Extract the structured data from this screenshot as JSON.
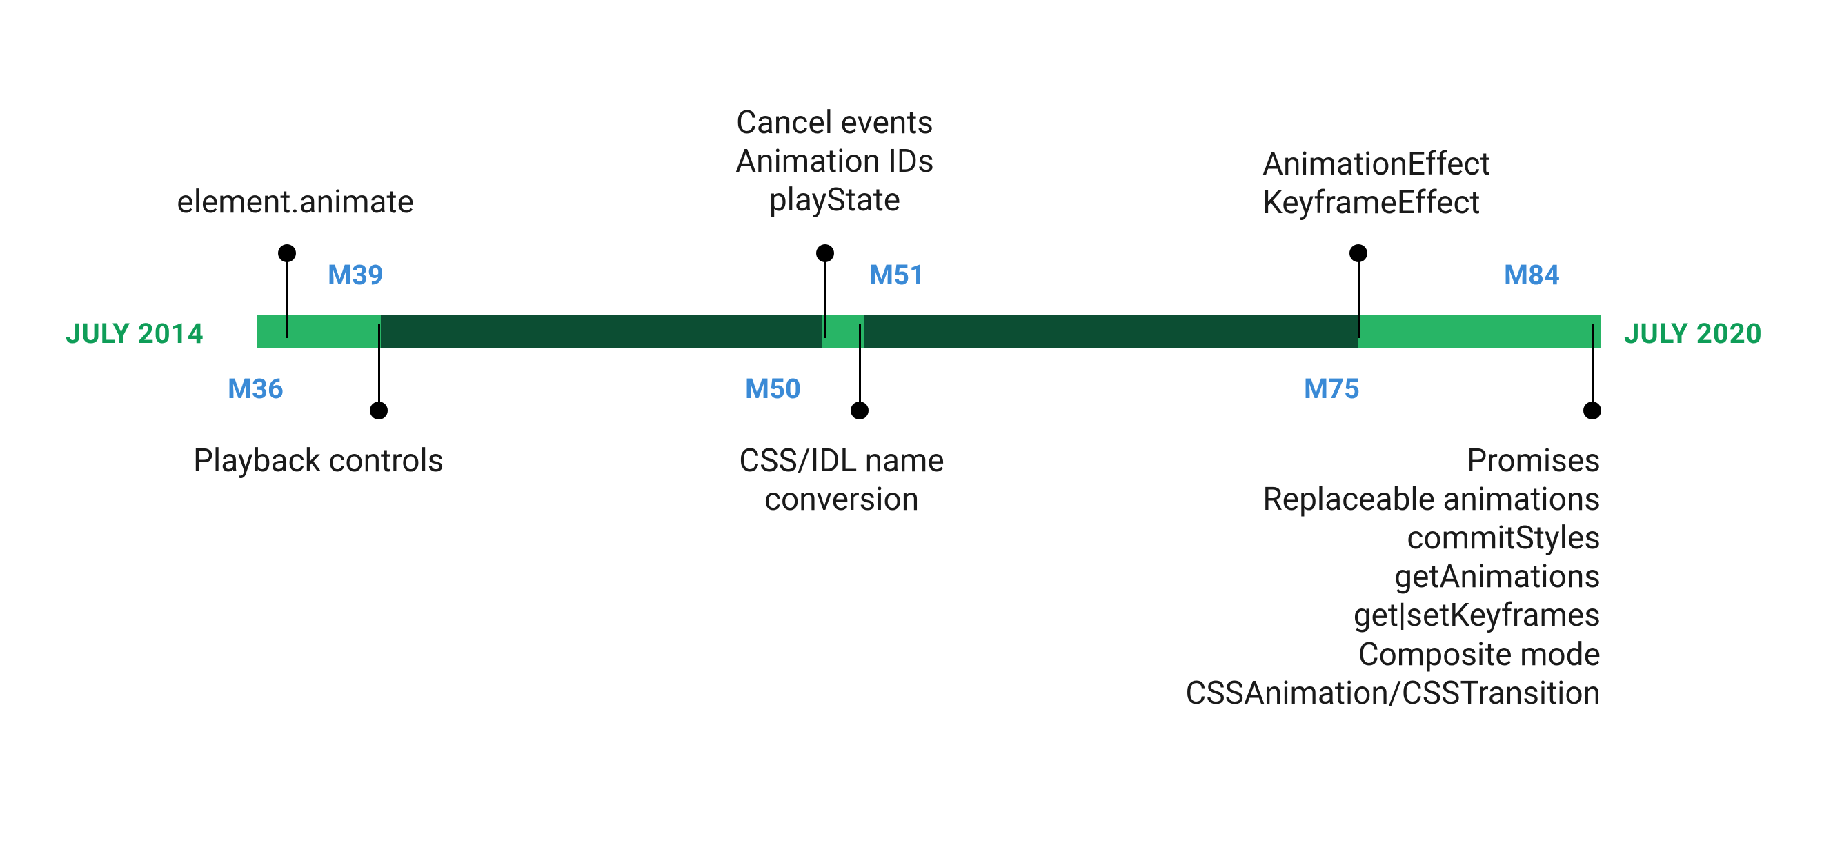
{
  "timeline": {
    "start_label": "JULY 2014",
    "end_label": "JULY 2020",
    "colors": {
      "light_green": "#28b566",
      "dark_green": "#0c4e33",
      "milestone_blue": "#3a8ad6",
      "date_green": "#0f9d58"
    },
    "events": [
      {
        "milestone": "M36",
        "position": "above",
        "lines": [
          "element.animate"
        ]
      },
      {
        "milestone": "M39",
        "position": "below",
        "lines": [
          "Playback controls"
        ]
      },
      {
        "milestone": "M50",
        "position": "below",
        "lines": [
          "CSS/IDL name",
          "conversion"
        ]
      },
      {
        "milestone": "M51",
        "position": "above",
        "lines": [
          "Cancel events",
          "Animation IDs",
          "playState"
        ]
      },
      {
        "milestone": "M75",
        "position": "above",
        "lines": [
          "AnimationEffect",
          "KeyframeEffect"
        ]
      },
      {
        "milestone": "M84",
        "position": "below",
        "lines": [
          "Promises",
          "Replaceable animations",
          "commitStyles",
          "getAnimations",
          "get|setKeyframes",
          "Composite mode",
          "CSSAnimation/CSSTransition"
        ]
      }
    ]
  }
}
